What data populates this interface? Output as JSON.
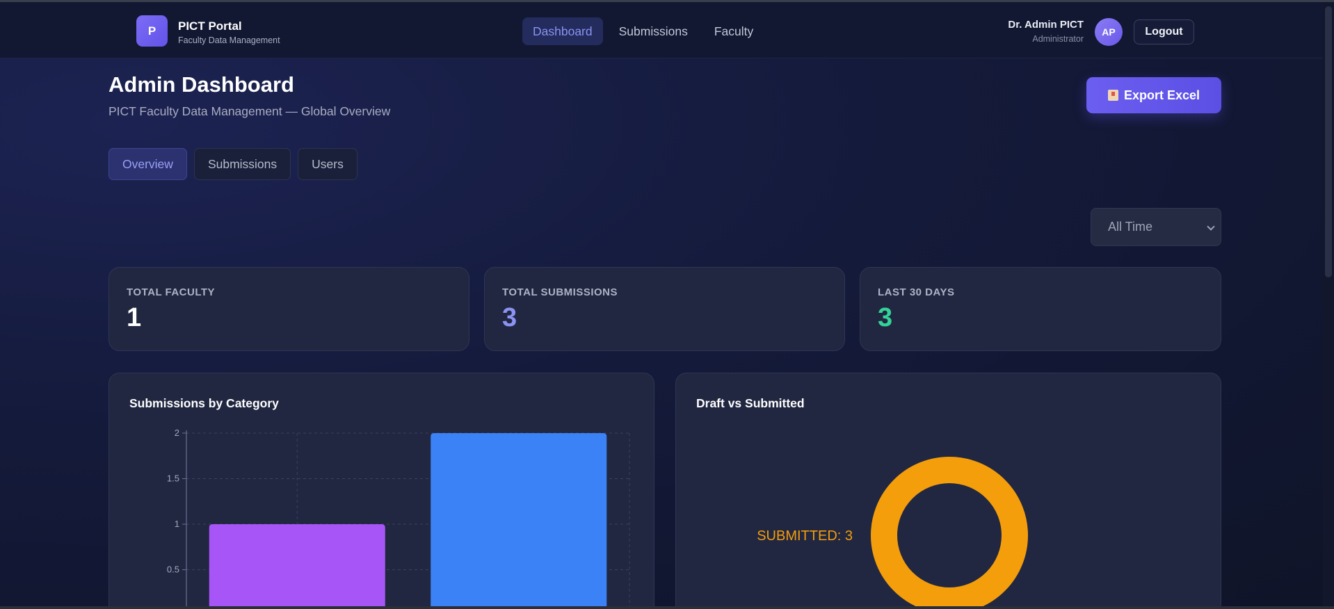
{
  "navbar": {
    "logo_letter": "P",
    "brand_title": "PICT Portal",
    "brand_subtitle": "Faculty Data Management",
    "links": [
      "Dashboard",
      "Submissions",
      "Faculty"
    ],
    "active_link": "Dashboard",
    "user_name": "Dr. Admin PICT",
    "user_role": "Administrator",
    "avatar_initials": "AP",
    "logout_label": "Logout"
  },
  "header": {
    "title": "Admin Dashboard",
    "subtitle": "PICT Faculty Data Management — Global Overview",
    "export_label": "Export Excel",
    "export_icon": "clipboard-icon"
  },
  "tabs": [
    "Overview",
    "Submissions",
    "Users"
  ],
  "active_tab": "Overview",
  "filter": {
    "selected": "All Time"
  },
  "stats": [
    {
      "label": "TOTAL FACULTY",
      "value": "1",
      "color": "#ffffff"
    },
    {
      "label": "TOTAL SUBMISSIONS",
      "value": "3",
      "color": "#8b93f3"
    },
    {
      "label": "LAST 30 DAYS",
      "value": "3",
      "color": "#34d399"
    }
  ],
  "charts": {
    "bar_title": "Submissions by Category",
    "donut_title": "Draft vs Submitted"
  },
  "chart_data": [
    {
      "type": "bar",
      "title": "Submissions by Category",
      "categories": [
        "",
        ""
      ],
      "values": [
        1,
        2
      ],
      "colors": [
        "#a855f7",
        "#3b82f6"
      ],
      "ylim": [
        0,
        2
      ],
      "yticks": [
        "0.5",
        "1",
        "1.5",
        "2"
      ],
      "grid": true
    },
    {
      "type": "pie",
      "title": "Draft vs Submitted",
      "donut": true,
      "slices": [
        {
          "label": "SUBMITTED: 3",
          "value": 3,
          "color": "#f59e0b"
        }
      ]
    }
  ]
}
